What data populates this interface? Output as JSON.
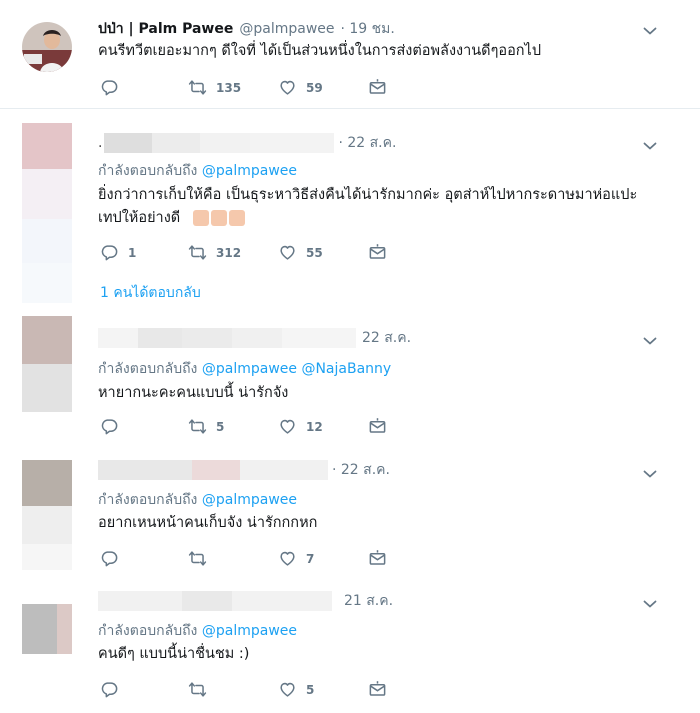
{
  "tweets": [
    {
      "name": "ปป่า | Palm Pawee",
      "handle": "@palmpawee",
      "time": "· 19 ชม.",
      "text": "คนรีทวีตเยอะมากๆ ดีใจที่ ได้เป็นส่วนหนึ่งในการส่งต่อพลังงานดีๆออกไป",
      "reply_count": "",
      "retweet_count": "135",
      "like_count": "59"
    },
    {
      "time": "· 22 ส.ค.",
      "replying_label": "กำลังตอบกลับถึง",
      "mentions": [
        "@palmpawee"
      ],
      "text_line1": "ยิ่งกว่าการเก็บให้คือ เป็นธุระหาวิธีส่งคืนได้น่ารักมากค่ะ อุตส่าห์ไปหากระดาษมาห่อแปะ",
      "text_line2": "เทปให้อย่างดี",
      "emoji": "👍🏻👍🏻👍🏻",
      "reply_count": "1",
      "retweet_count": "312",
      "like_count": "55",
      "more_replies": "1 คนได้ตอบกลับ"
    },
    {
      "time": "22 ส.ค.",
      "replying_label": "กำลังตอบกลับถึง",
      "mentions": [
        "@palmpawee",
        "@NajaBanny"
      ],
      "text": "หายากนะคะคนแบบนี้ น่ารักจัง",
      "reply_count": "",
      "retweet_count": "5",
      "like_count": "12"
    },
    {
      "time": "· 22 ส.ค.",
      "replying_label": "กำลังตอบกลับถึง",
      "mentions": [
        "@palmpawee"
      ],
      "text": "อยากเหนหน้าคนเก็บจัง น่ารักกกหก",
      "reply_count": "",
      "retweet_count": "",
      "like_count": "7"
    },
    {
      "time": "21 ส.ค.",
      "replying_label": "กำลังตอบกลับถึง",
      "mentions": [
        "@palmpawee"
      ],
      "text": "คนดีๆ แบบนี้น่าชื่นชม :)",
      "reply_count": "",
      "retweet_count": "",
      "like_count": "5"
    }
  ],
  "icons": {
    "reply": "reply-icon",
    "retweet": "retweet-icon",
    "like": "heart-icon",
    "dm": "envelope-icon",
    "menu": "chevron-down-icon"
  },
  "colors": {
    "link": "#1da1f2",
    "muted": "#657786",
    "border": "#e6ecf0",
    "thread_line": "#9fd0f5"
  }
}
